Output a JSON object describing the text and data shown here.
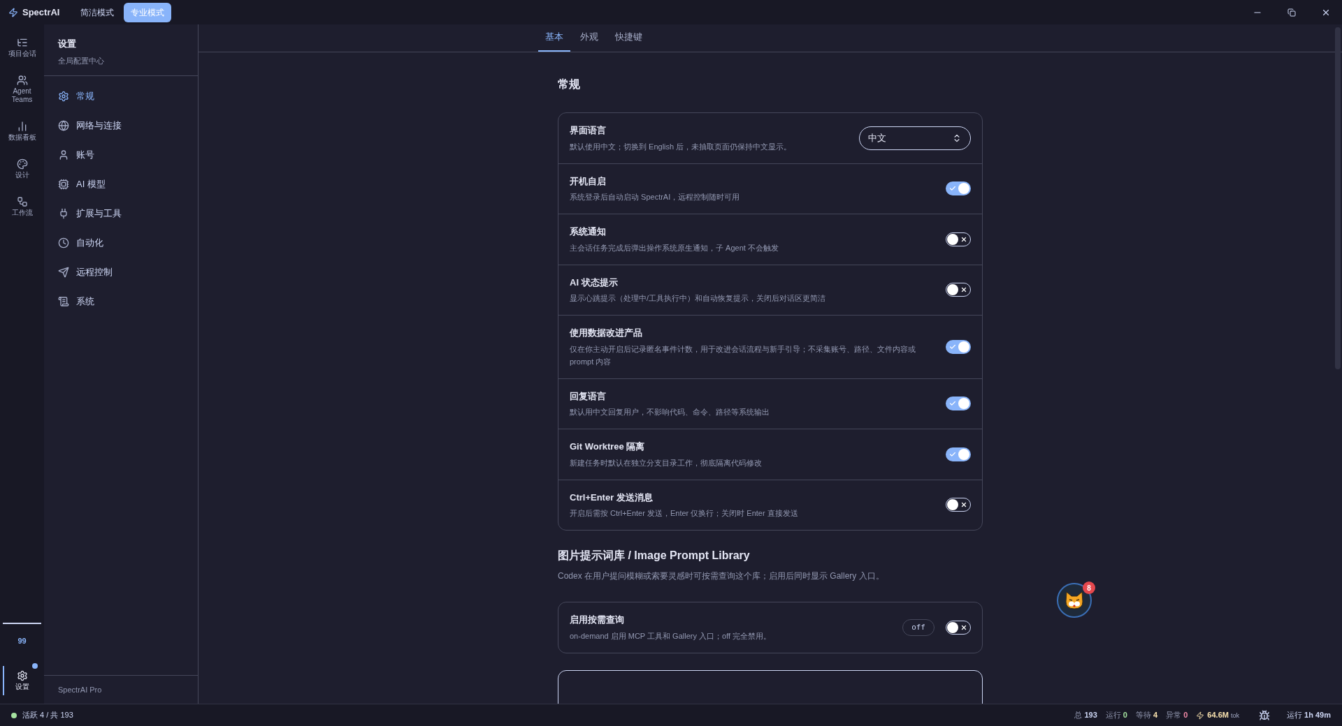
{
  "titlebar": {
    "app_name": "SpectrAI",
    "modes": [
      {
        "label": "简洁模式",
        "selected": false
      },
      {
        "label": "专业模式",
        "selected": true
      }
    ]
  },
  "rail": {
    "items": [
      {
        "label": "项目会话",
        "selected": false
      },
      {
        "label": "Agent Teams",
        "selected": false
      },
      {
        "label": "数据看板",
        "selected": false
      },
      {
        "label": "设计",
        "selected": false
      },
      {
        "label": "工作流",
        "selected": false
      }
    ],
    "counter": "99",
    "settings": {
      "label": "设置",
      "selected": true,
      "notification": true
    }
  },
  "sidebar": {
    "title": "设置",
    "subtitle": "全局配置中心",
    "items": [
      {
        "label": "常规",
        "selected": true
      },
      {
        "label": "网络与连接",
        "selected": false
      },
      {
        "label": "账号",
        "selected": false
      },
      {
        "label": "AI 模型",
        "selected": false
      },
      {
        "label": "扩展与工具",
        "selected": false
      },
      {
        "label": "自动化",
        "selected": false
      },
      {
        "label": "远程控制",
        "selected": false
      },
      {
        "label": "系统",
        "selected": false
      }
    ],
    "footer": "SpectrAI Pro"
  },
  "tabs": [
    {
      "label": "基本",
      "selected": true
    },
    {
      "label": "外观",
      "selected": false
    },
    {
      "label": "快捷键",
      "selected": false
    }
  ],
  "sections": [
    {
      "title": "常规",
      "rows": [
        {
          "kind": "select",
          "title": "界面语言",
          "description": "默认使用中文；切换到 English 后，未抽取页面仍保持中文显示。",
          "value": "中文"
        },
        {
          "kind": "toggle",
          "title": "开机自启",
          "description": "系统登录后自动启动 SpectrAI，远程控制随时可用",
          "on": true
        },
        {
          "kind": "toggle",
          "title": "系统通知",
          "description": "主会话任务完成后弹出操作系统原生通知，子 Agent 不会触发",
          "on": false
        },
        {
          "kind": "toggle",
          "title": "AI 状态提示",
          "description": "显示心跳提示（处理中/工具执行中）和自动恢复提示，关闭后对话区更简洁",
          "on": false
        },
        {
          "kind": "toggle",
          "title": "使用数据改进产品",
          "description": "仅在你主动开启后记录匿名事件计数，用于改进会话流程与新手引导；不采集账号、路径、文件内容或 prompt 内容",
          "on": true
        },
        {
          "kind": "toggle",
          "title": "回复语言",
          "description": "默认用中文回复用户，不影响代码、命令、路径等系统输出",
          "on": true
        },
        {
          "kind": "toggle",
          "title": "Git Worktree 隔离",
          "description": "新建任务时默认在独立分支目录工作，彻底隔离代码修改",
          "on": true
        },
        {
          "kind": "toggle",
          "title": "Ctrl+Enter 发送消息",
          "description": "开启后需按 Ctrl+Enter 发送，Enter 仅换行；关闭时 Enter 直接发送",
          "on": false
        }
      ]
    },
    {
      "title": "图片提示词库 / Image Prompt Library",
      "description": "Codex 在用户提问模糊或索要灵感时可按需查询这个库；启用后同时显示 Gallery 入口。",
      "rows": [
        {
          "kind": "toggle",
          "title": "启用按需查询",
          "description": "on-demand 启用 MCP 工具和 Gallery 入口；off 完全禁用。",
          "badge": "off",
          "on": false
        }
      ]
    }
  ],
  "assistant": {
    "badge": "8"
  },
  "status_bar": {
    "summary": "活跃 4 / 共 193",
    "stats": [
      {
        "label": "总",
        "value": "193",
        "color": "#cdd6f4"
      },
      {
        "label": "运行",
        "value": "0",
        "color": "#a6e3a1"
      },
      {
        "label": "等待",
        "value": "4",
        "color": "#f9e2af"
      },
      {
        "label": "异常",
        "value": "0",
        "color": "#f38ba8"
      }
    ],
    "tokens": "64.6M",
    "tokens_unit": "tok",
    "uptime_label": "运行",
    "uptime": "1h 49m"
  }
}
